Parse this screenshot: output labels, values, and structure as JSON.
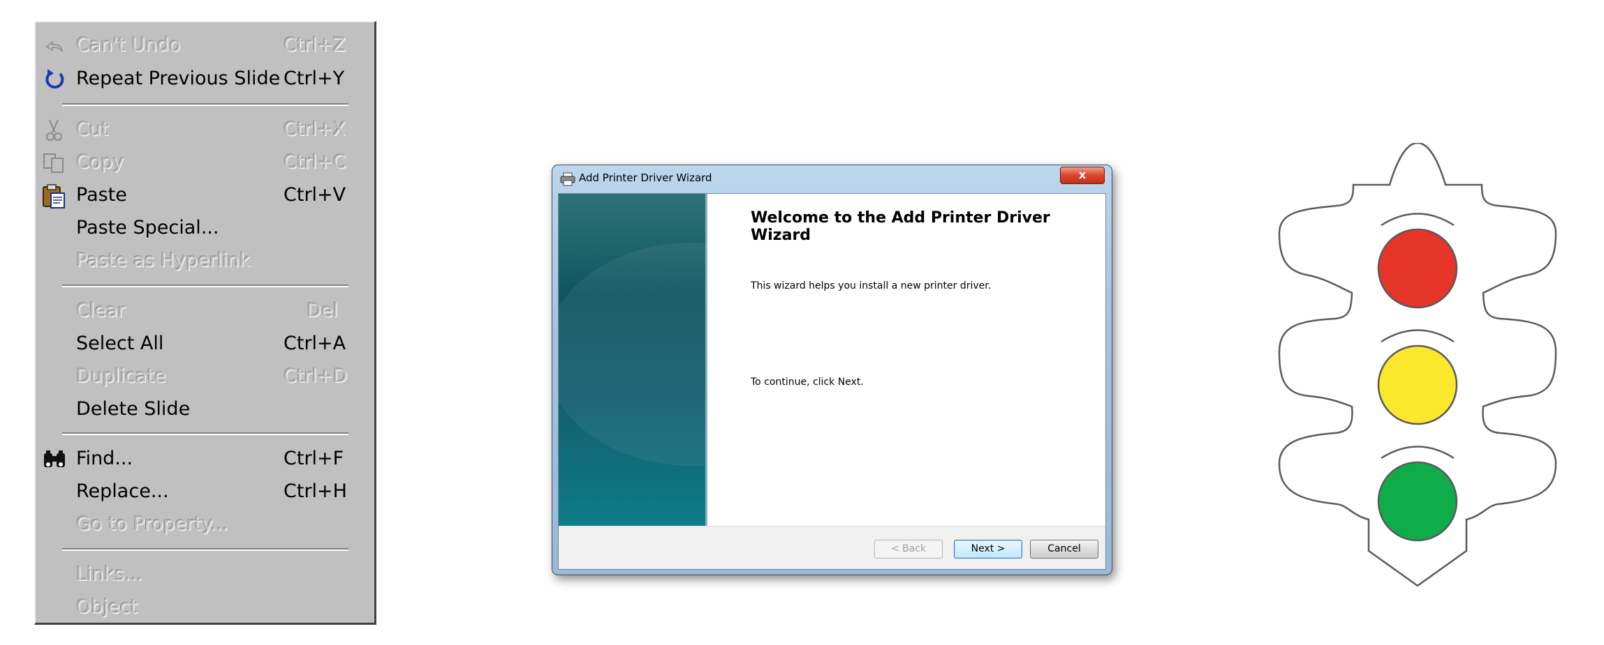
{
  "edit_menu": {
    "items": [
      {
        "label": "Can't Undo",
        "shortcut": "Ctrl+Z",
        "icon": "undo-icon"
      },
      {
        "label": "Repeat Previous Slide",
        "shortcut": "Ctrl+Y",
        "icon": "redo-icon"
      },
      {
        "label": "Cut",
        "shortcut": "Ctrl+X",
        "icon": "scissors-icon"
      },
      {
        "label": "Copy",
        "shortcut": "Ctrl+C",
        "icon": "copy-icon"
      },
      {
        "label": "Paste",
        "shortcut": "Ctrl+V",
        "icon": "clipboard-icon"
      },
      {
        "label": "Paste Special...",
        "shortcut": ""
      },
      {
        "label": "Paste as Hyperlink",
        "shortcut": ""
      },
      {
        "label": "Clear",
        "shortcut": "Del"
      },
      {
        "label": "Select All",
        "shortcut": "Ctrl+A"
      },
      {
        "label": "Duplicate",
        "shortcut": "Ctrl+D"
      },
      {
        "label": "Delete Slide",
        "shortcut": ""
      },
      {
        "label": "Find...",
        "shortcut": "Ctrl+F",
        "icon": "binoculars-icon"
      },
      {
        "label": "Replace...",
        "shortcut": "Ctrl+H"
      },
      {
        "label": "Go to Property...",
        "shortcut": ""
      },
      {
        "label": "Links...",
        "shortcut": ""
      },
      {
        "label": "Object",
        "shortcut": ""
      }
    ]
  },
  "wizard": {
    "title": "Add Printer Driver Wizard",
    "close_label": "x",
    "heading": "Welcome to the Add Printer Driver Wizard",
    "intro_text": "This wizard helps you install a new printer driver.",
    "continue_text": "To continue, click Next.",
    "back_label": "< Back",
    "next_label": "Next >",
    "cancel_label": "Cancel"
  },
  "traffic_light": {
    "colors": {
      "red": "#e8352a",
      "yellow": "#fbe72c",
      "green": "#0ead4a"
    }
  }
}
